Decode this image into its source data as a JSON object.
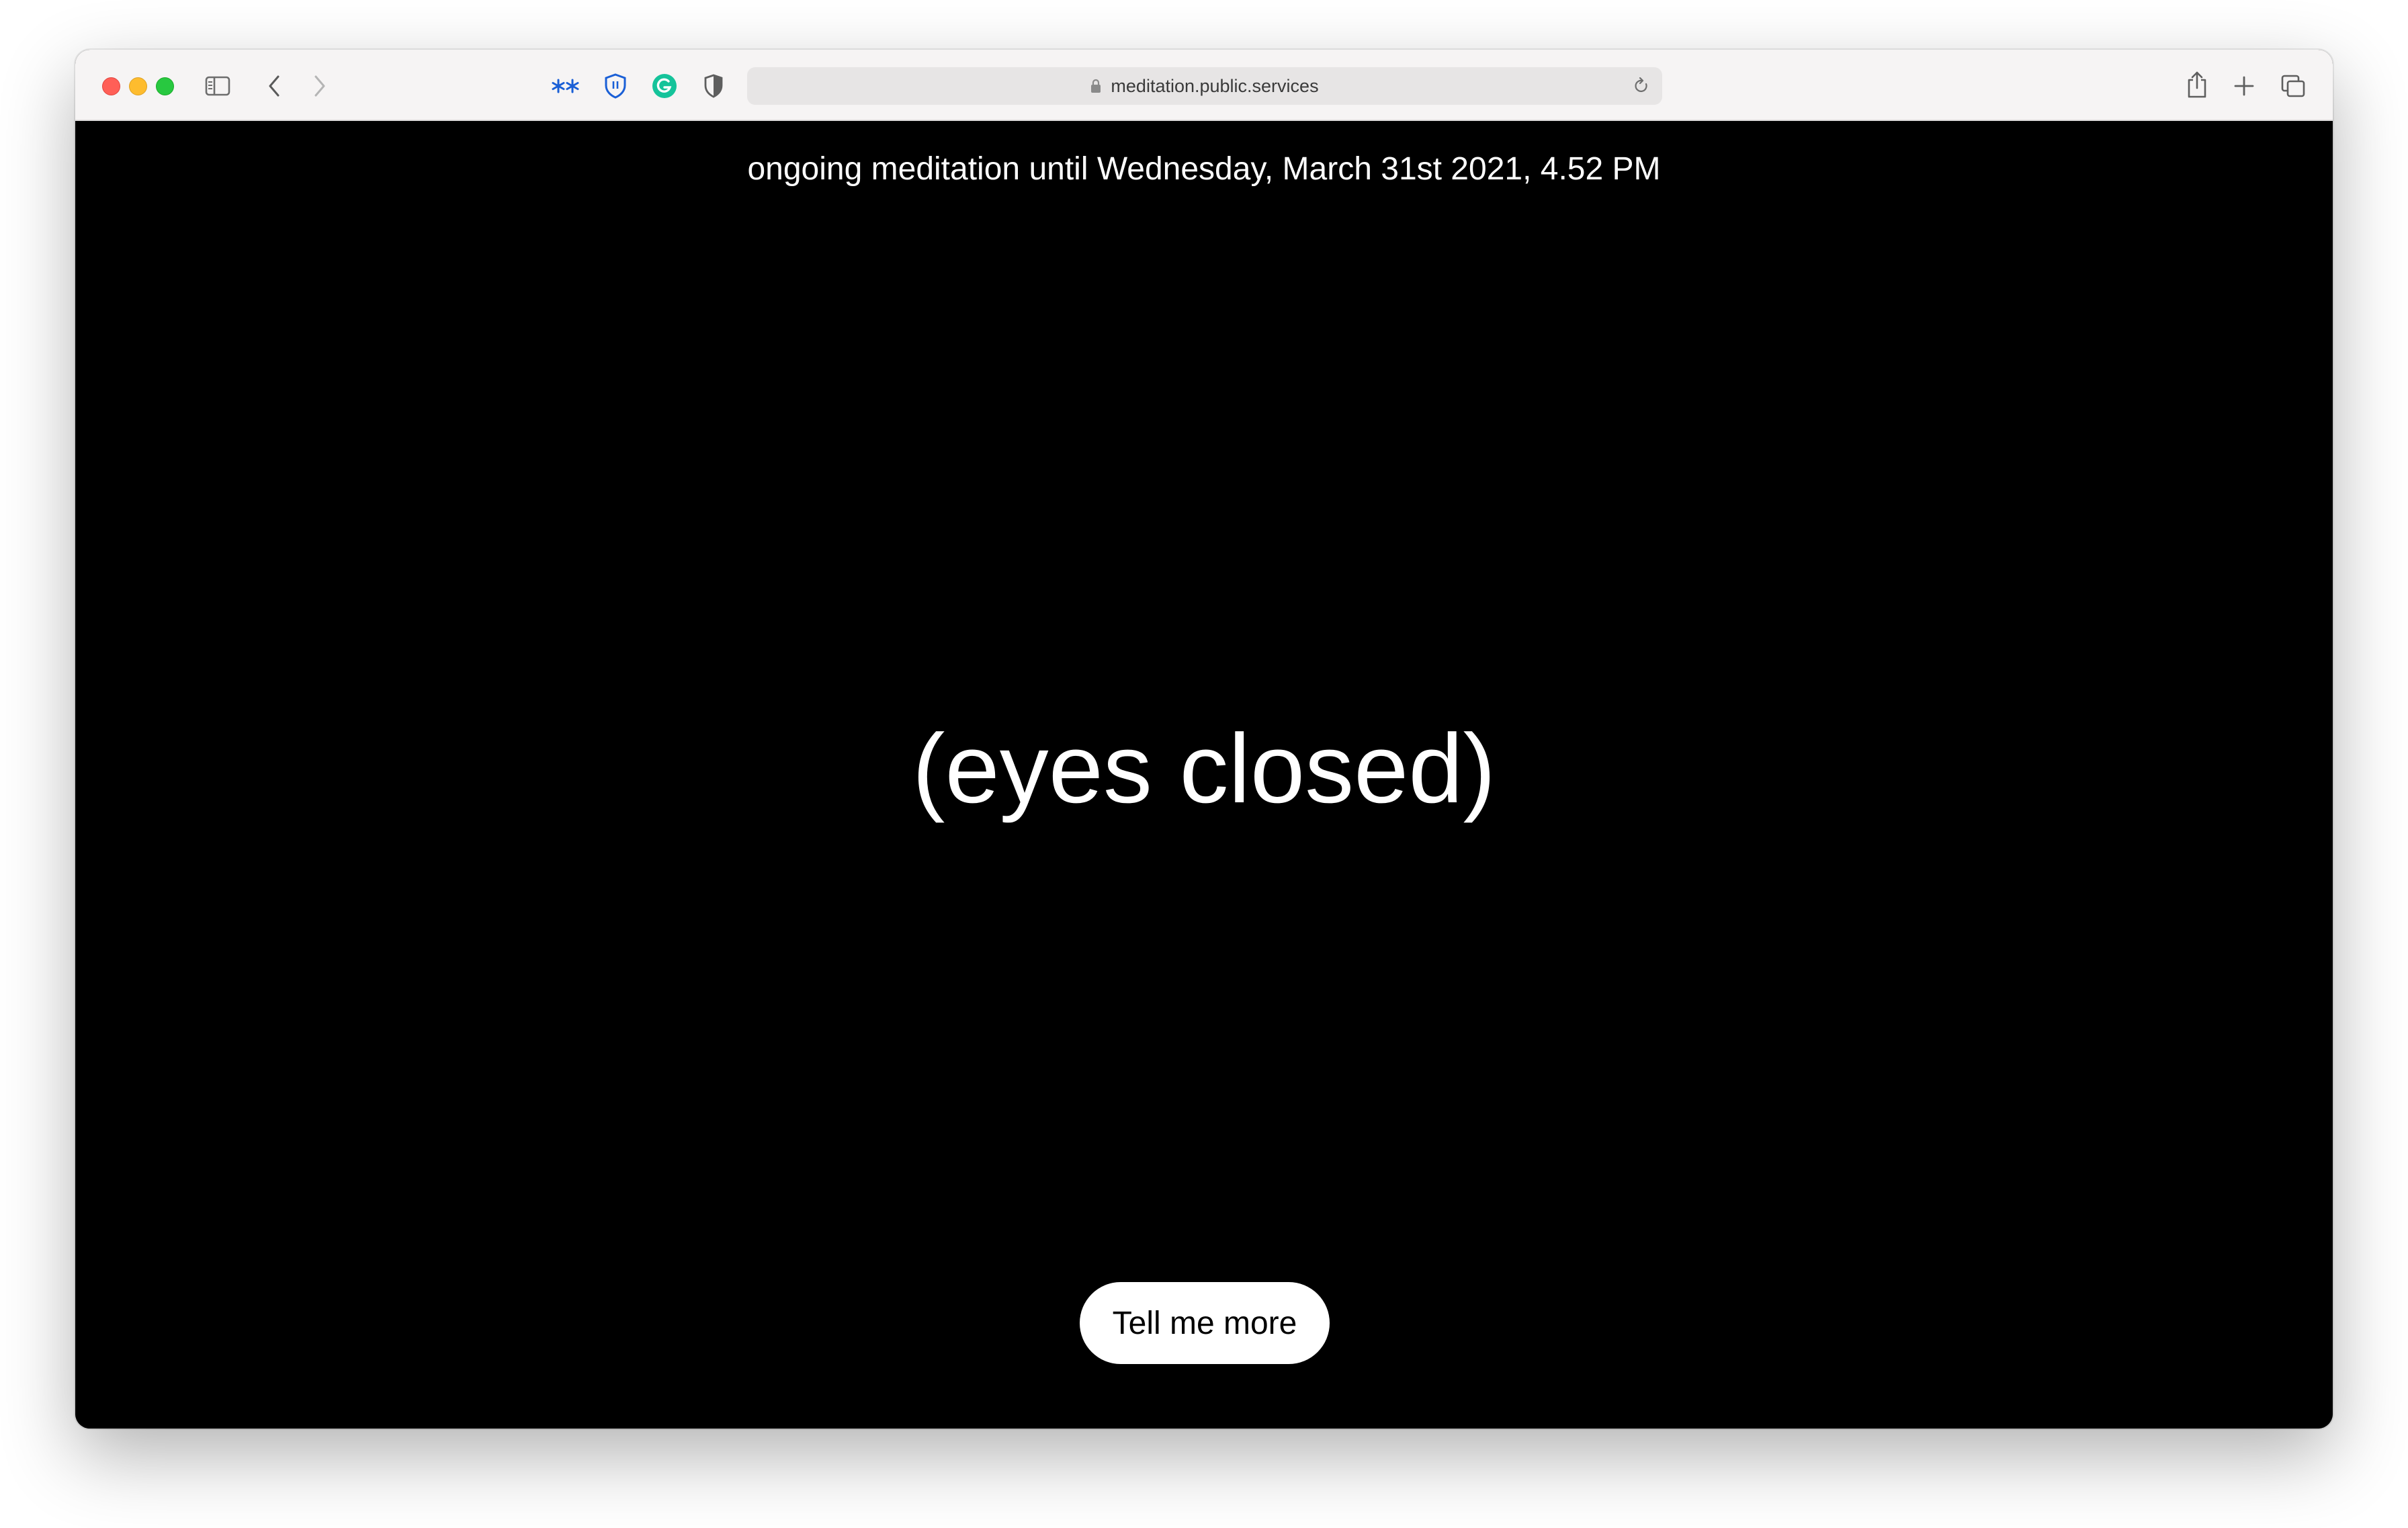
{
  "browser": {
    "address": "meditation.public.services",
    "icons": {
      "sidebar": "sidebar-icon",
      "back": "chevron-left-icon",
      "forward": "chevron-right-icon",
      "extension_1": "asterisks-icon",
      "extension_2": "shield-icon",
      "extension_3": "grammarly-icon",
      "extension_4": "half-shield-icon",
      "lock": "lock-icon",
      "reload": "reload-icon",
      "share": "share-icon",
      "new_tab": "plus-icon",
      "tabs_overview": "tabs-icon"
    },
    "colors": {
      "close": "#ff5f57",
      "minimize": "#febc2e",
      "maximize": "#28c840",
      "extension_blue": "#1a5fd6",
      "extension_green": "#15c39a"
    }
  },
  "page": {
    "status_line": "ongoing meditation until Wednesday, March 31st 2021, 4.52 PM",
    "headline": "(eyes closed)",
    "cta_label": "Tell me more",
    "colors": {
      "background": "#000000",
      "text": "#ffffff",
      "button_bg": "#ffffff",
      "button_text": "#000000"
    }
  }
}
